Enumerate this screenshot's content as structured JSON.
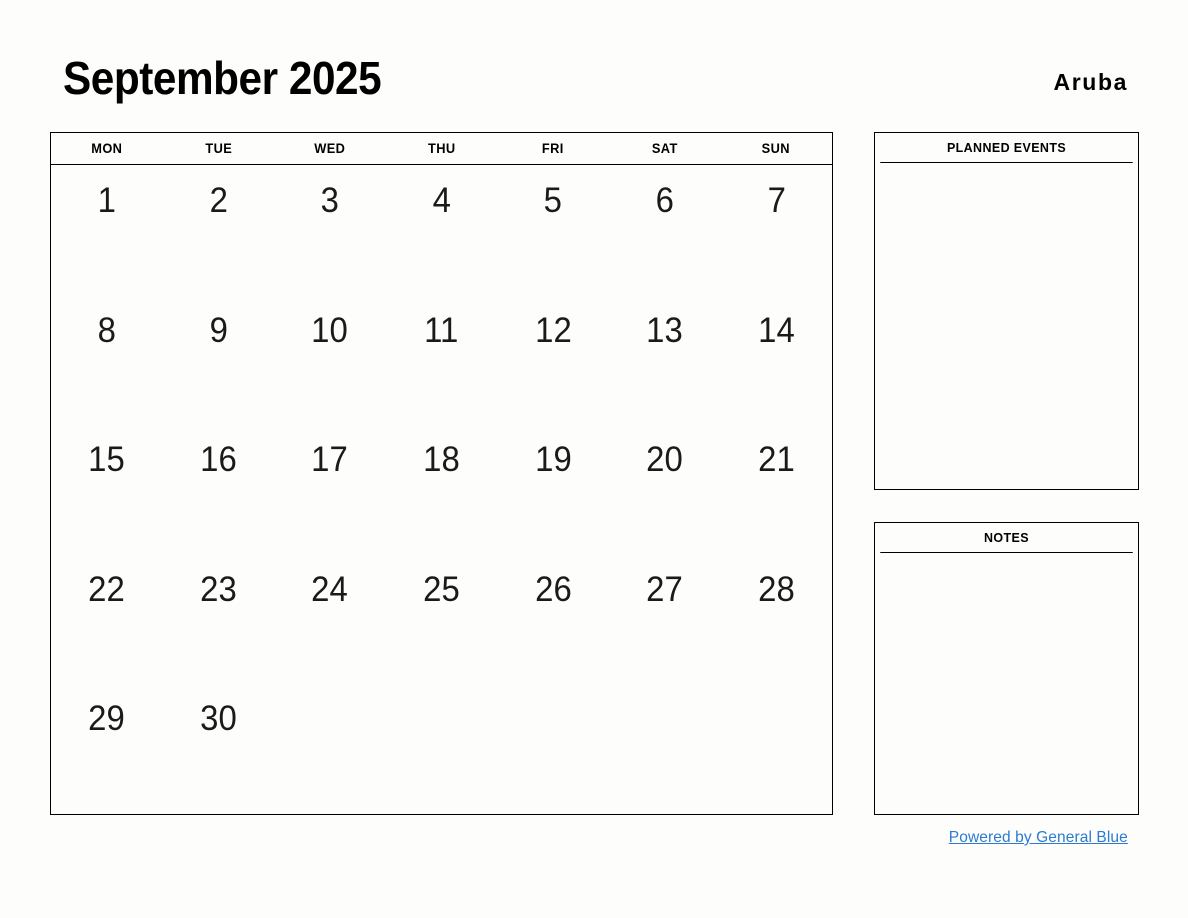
{
  "header": {
    "month_title": "September 2025",
    "location": "Aruba"
  },
  "calendar": {
    "weekdays": [
      "MON",
      "TUE",
      "WED",
      "THU",
      "FRI",
      "SAT",
      "SUN"
    ],
    "weeks": [
      [
        "1",
        "2",
        "3",
        "4",
        "5",
        "6",
        "7"
      ],
      [
        "8",
        "9",
        "10",
        "11",
        "12",
        "13",
        "14"
      ],
      [
        "15",
        "16",
        "17",
        "18",
        "19",
        "20",
        "21"
      ],
      [
        "22",
        "23",
        "24",
        "25",
        "26",
        "27",
        "28"
      ],
      [
        "29",
        "30",
        "",
        "",
        "",
        "",
        ""
      ]
    ]
  },
  "panels": {
    "planned_events": {
      "title": "PLANNED EVENTS",
      "content": ""
    },
    "notes": {
      "title": "NOTES",
      "content": ""
    }
  },
  "footer": {
    "link_label": "Powered by General Blue"
  },
  "colors": {
    "background": "#fdfdfb",
    "border": "#000000",
    "text": "#111111",
    "link": "#2b7bd0"
  }
}
